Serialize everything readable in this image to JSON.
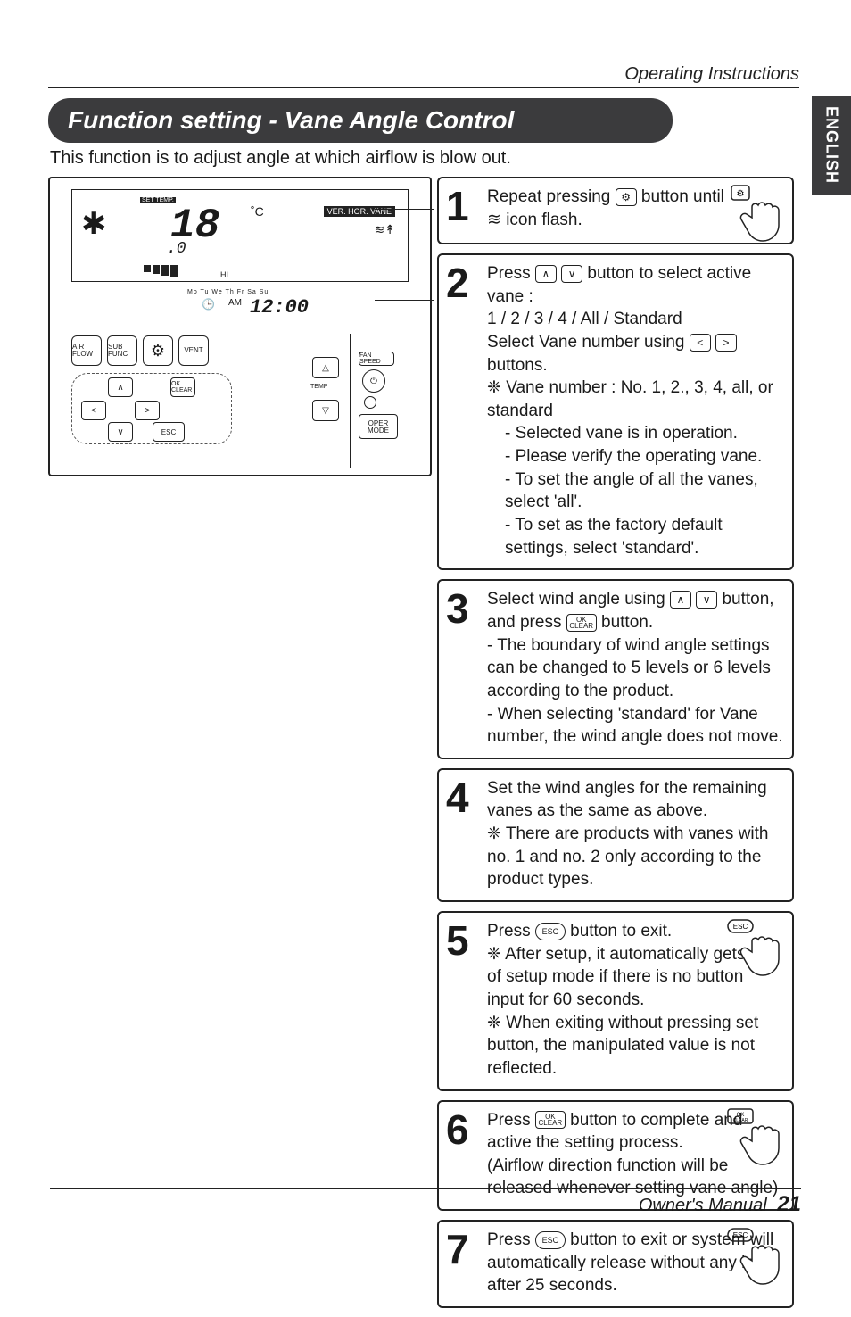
{
  "page": {
    "header_right": "Operating Instructions",
    "tab": "ENGLISH",
    "banner": "Function setting - Vane Angle Control",
    "intro": "This function is to adjust angle at which airflow is blow out.",
    "footer_label": "Owner's Manual",
    "footer_page": "21"
  },
  "device": {
    "settemp": "SET TEMP.",
    "temp": "18",
    "temp_sub": ".0",
    "deg": "˚C",
    "ver": "VER. HOR. VANE",
    "hi": "HI",
    "days": "Mo  Tu  We  Th  Fr  Sa  Su",
    "am": "AM",
    "time": "12:00",
    "btn_airflow": "AIR\nFLOW",
    "btn_subfunc": "SUB\nFUNC",
    "btn_vent": "VENT",
    "btn_fanspeed": "FAN\nSPEED",
    "btn_temp_lbl": "TEMP",
    "btn_oper": "OPER MODE",
    "btn_ok": "OK\nCLEAR",
    "btn_esc": "ESC"
  },
  "icons": {
    "gear": "⚙",
    "wave": "≋",
    "snow": "✱",
    "up": "∧",
    "down": "∨",
    "left": "<",
    "right": ">",
    "ok": "OK CLEAR",
    "esc": "ESC",
    "power": "⏻",
    "clock": "🕒"
  },
  "steps": [
    {
      "num": "1",
      "parts": [
        "Repeat pressing ",
        " button until ",
        " icon flash."
      ],
      "icon1": "gear",
      "icon2": "wave",
      "hand": true,
      "hand_btn": "gear"
    },
    {
      "num": "2",
      "lines": [
        "Press __UP__ __DOWN__ button to select active vane :",
        "1 / 2 / 3 / 4 / All / Standard",
        "Select Vane number using __LEFT__ __RIGHT__ buttons.",
        "❈ Vane number : No. 1, 2., 3, 4, all, or standard",
        "  - Selected vane is in operation.",
        "  - Please verify the operating vane.",
        "  - To set the angle of all the vanes, select 'all'.",
        "  - To set as the factory default settings, select 'standard'."
      ]
    },
    {
      "num": "3",
      "lines": [
        "Select wind angle using __UP__ __DOWN__ button, and press __OK__ button.",
        "- The boundary of wind angle settings can be changed to 5 levels or 6 levels according to the product.",
        "- When selecting 'standard' for Vane number, the wind angle does not move."
      ]
    },
    {
      "num": "4",
      "lines": [
        "Set the wind angles for the remaining vanes as the same as above.",
        "❈ There are products with vanes with no. 1 and no. 2 only according to the product types."
      ]
    },
    {
      "num": "5",
      "lines": [
        "Press __ESC__ button to exit.",
        "❈ After setup, it automatically gets out of setup mode if there is no button input for 60 seconds.",
        "❈ When exiting without pressing set button, the manipulated value is not reflected."
      ],
      "hand": true,
      "hand_btn": "esc"
    },
    {
      "num": "6",
      "lines": [
        "Press __OK__ button to complete and active the setting process.",
        "(Airflow direction function will be released whenever setting vane angle)"
      ],
      "hand": true,
      "hand_btn": "ok"
    },
    {
      "num": "7",
      "lines": [
        "Press __ESC__ button to exit or system will automatically release without any input after 25 seconds."
      ],
      "hand": true,
      "hand_btn": "esc"
    }
  ]
}
